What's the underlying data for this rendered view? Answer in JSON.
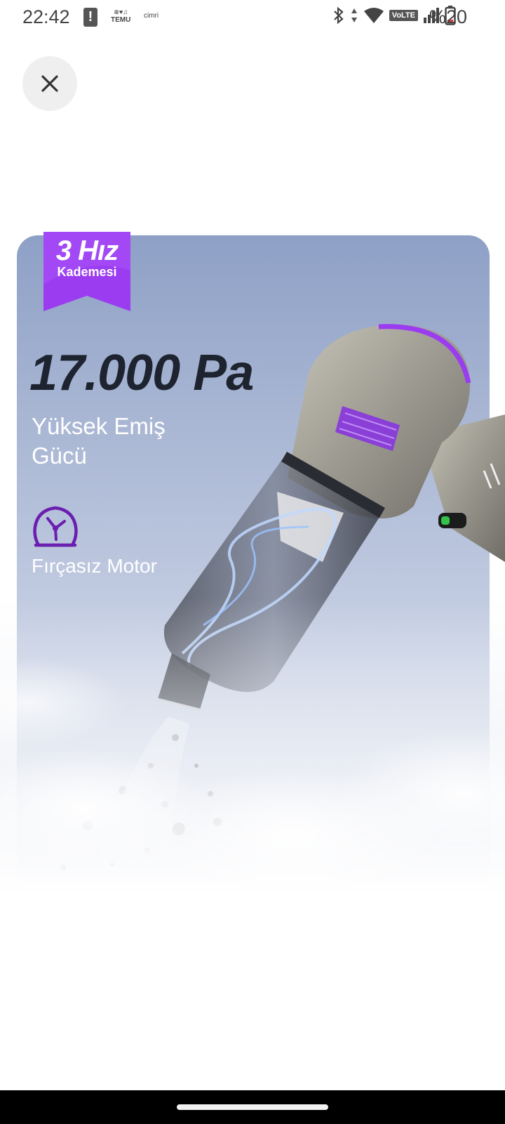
{
  "status_bar": {
    "time": "22:42",
    "alert_icon": "exclamation-icon",
    "app_icons": [
      "TEMU",
      "cimri"
    ],
    "network_label": "VoLTE",
    "battery_percent": "%20"
  },
  "close_button": {
    "icon": "close-icon"
  },
  "product": {
    "badge_title": "3 Hız",
    "badge_subtitle": "Kademesi",
    "headline": "17.000 Pa",
    "feature_1": "Yüksek Emiş Gücü",
    "feature_2": "Fırçasız Motor",
    "accent_color": "#9b3cf0",
    "headline_color": "#1e2330"
  }
}
